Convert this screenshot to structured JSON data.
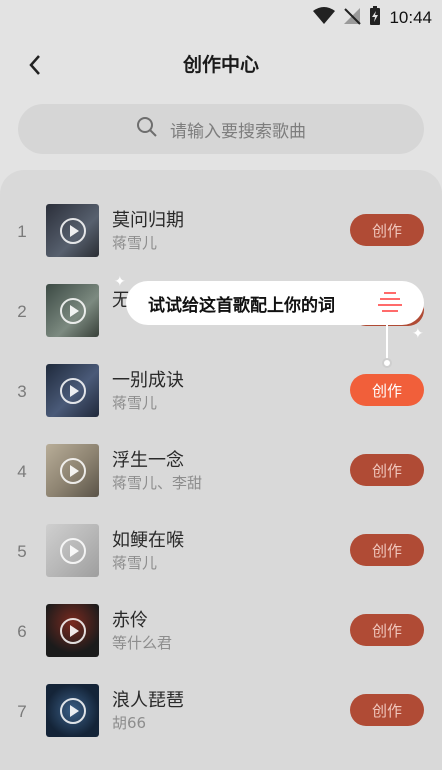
{
  "status": {
    "time": "10:44"
  },
  "header": {
    "title": "创作中心"
  },
  "search": {
    "placeholder": "请输入要搜索歌曲"
  },
  "songs": [
    {
      "index": "1",
      "name": "莫问归期",
      "artist": "蒋雪儿",
      "button": "创作"
    },
    {
      "index": "2",
      "name": "无",
      "artist": "",
      "button": "创作"
    },
    {
      "index": "3",
      "name": "一别成诀",
      "artist": "蒋雪儿",
      "button": "创作"
    },
    {
      "index": "4",
      "name": "浮生一念",
      "artist": "蒋雪儿、李甜",
      "button": "创作"
    },
    {
      "index": "5",
      "name": "如鲠在喉",
      "artist": "蒋雪儿",
      "button": "创作"
    },
    {
      "index": "6",
      "name": "赤伶",
      "artist": "等什么君",
      "button": "创作"
    },
    {
      "index": "7",
      "name": "浪人琵琶",
      "artist": "胡66",
      "button": "创作"
    }
  ],
  "tooltip": {
    "text": "试试给这首歌配上你的词"
  },
  "colors": {
    "accent": "#f15f3a",
    "button_dim": "#b04b35",
    "background": "#e3e3e3"
  }
}
